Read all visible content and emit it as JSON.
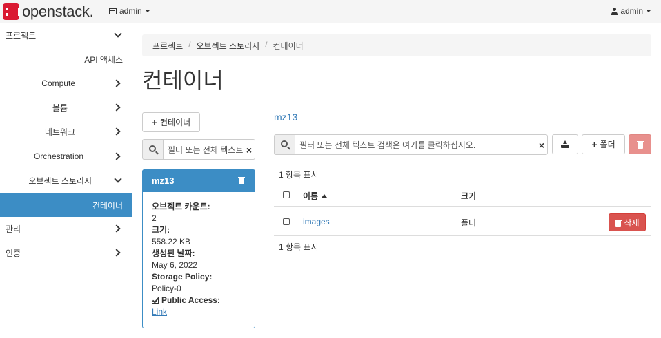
{
  "navbar": {
    "brand": "openstack.",
    "project_label": "admin",
    "user_label": "admin"
  },
  "sidebar": {
    "items": [
      {
        "label": "프로젝트",
        "chevron": "down"
      },
      {
        "label": "API 액세스",
        "chevron": "none"
      },
      {
        "label": "Compute",
        "chevron": "right"
      },
      {
        "label": "볼륨",
        "chevron": "right"
      },
      {
        "label": "네트워크",
        "chevron": "right"
      },
      {
        "label": "Orchestration",
        "chevron": "right"
      },
      {
        "label": "오브젝트 스토리지",
        "chevron": "down"
      },
      {
        "label": "컨테이너",
        "chevron": "none",
        "active": true
      },
      {
        "label": "관리",
        "chevron": "right"
      },
      {
        "label": "인증",
        "chevron": "right"
      }
    ]
  },
  "breadcrumb": {
    "items": [
      "프로젝트",
      "오브젝트 스토리지",
      "컨테이너"
    ],
    "separator": "/"
  },
  "page": {
    "title": "컨테이너"
  },
  "containers": {
    "add_button": "컨테이너",
    "filter_placeholder": "필터 또는 전체 텍스트",
    "card": {
      "name": "mz13",
      "object_count_label": "오브젝트 카운트:",
      "object_count": "2",
      "size_label": "크기:",
      "size": "558.22 KB",
      "created_label": "생성된 날짜:",
      "created": "May 6, 2022",
      "policy_label": "Storage Policy:",
      "policy": "Policy-0",
      "public_access_label": "Public Access:",
      "public_access_link": "Link"
    }
  },
  "objects": {
    "container_name": "mz13",
    "filter_placeholder": "필터 또는 전체 텍스트 검색은 여기를 클릭하십시오.",
    "folder_button": "폴더",
    "count_top": "1 항목 표시",
    "count_bottom": "1 항목 표시",
    "columns": {
      "name": "이름",
      "size": "크기"
    },
    "rows": [
      {
        "name": "images",
        "size": "폴더",
        "delete_label": "삭제"
      }
    ]
  },
  "colors": {
    "accent": "#3c8dc5",
    "danger": "#d9534f",
    "brand_red": "#da1a32"
  }
}
